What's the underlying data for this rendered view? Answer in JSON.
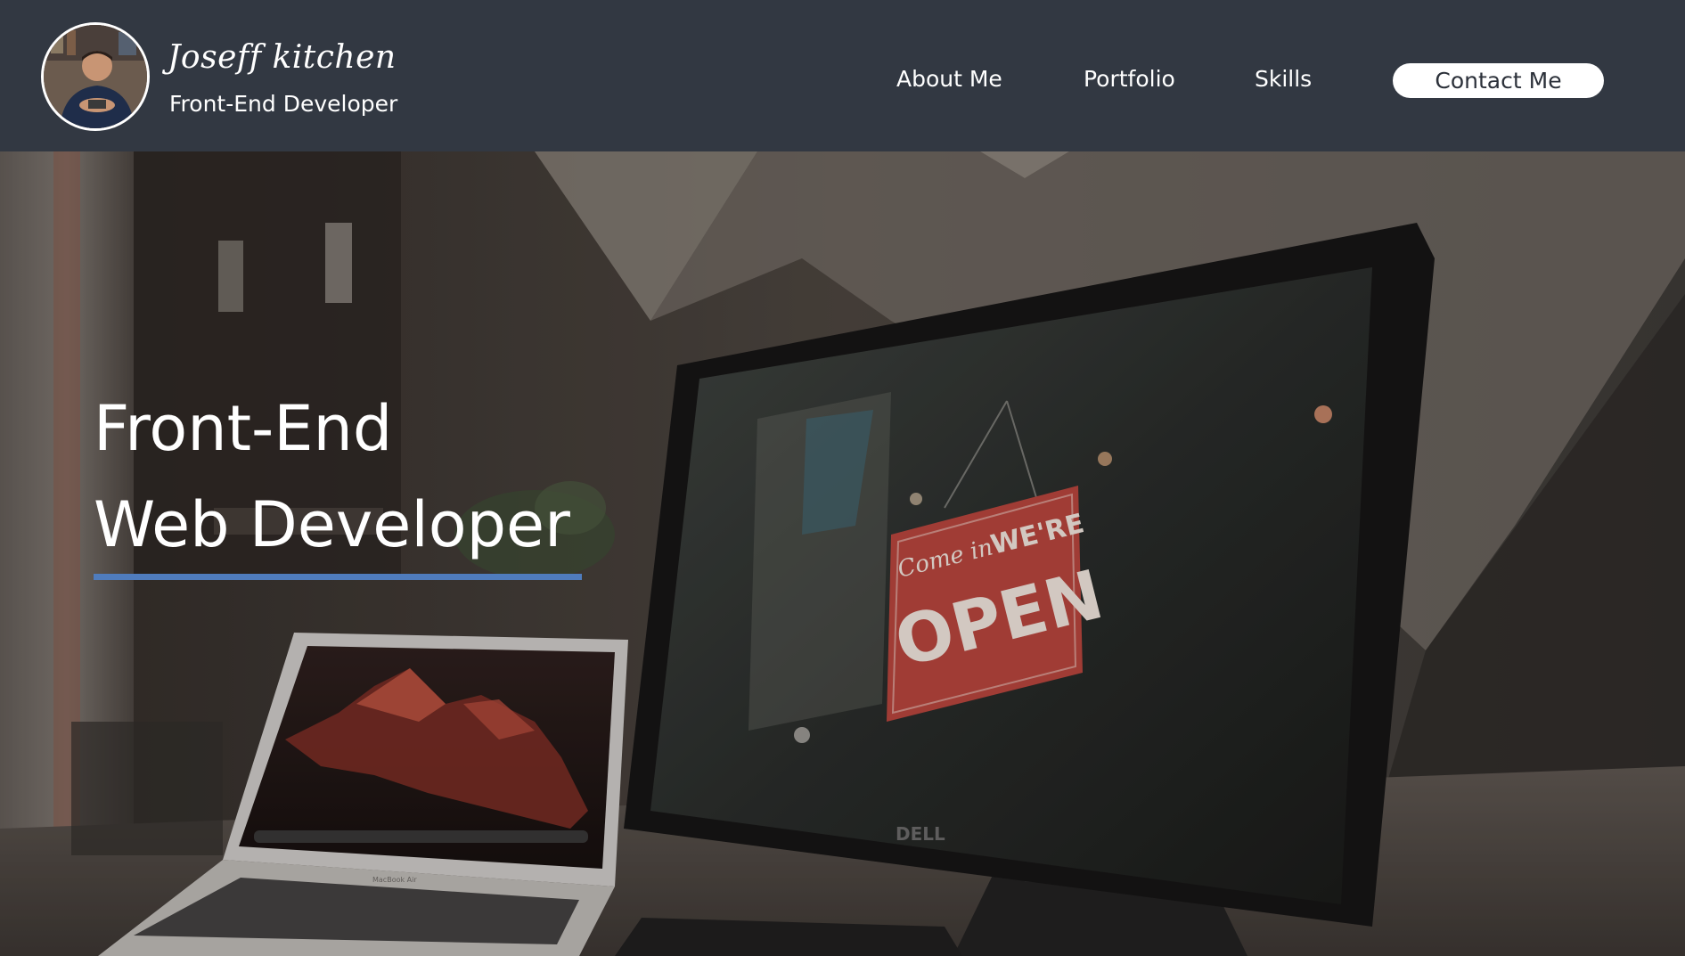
{
  "header": {
    "brand_name": "Joseff kitchen",
    "brand_role": "Front-End Developer",
    "nav": [
      {
        "label": "About Me"
      },
      {
        "label": "Portfolio"
      },
      {
        "label": "Skills"
      }
    ],
    "contact_label": "Contact Me"
  },
  "hero": {
    "title_line_1": "Front-End",
    "title_line_2": "Web Developer",
    "monitor_brand": "DELL",
    "laptop_label": "MacBook Air",
    "sign_script": "Come in",
    "sign_top": "WE'RE",
    "sign_main": "OPEN"
  },
  "colors": {
    "header_bg": "#323842",
    "accent_underline": "#4f7cbd",
    "button_bg": "#ffffff",
    "sign_red": "#b8433b"
  },
  "icons": {
    "avatar": "profile-photo"
  }
}
